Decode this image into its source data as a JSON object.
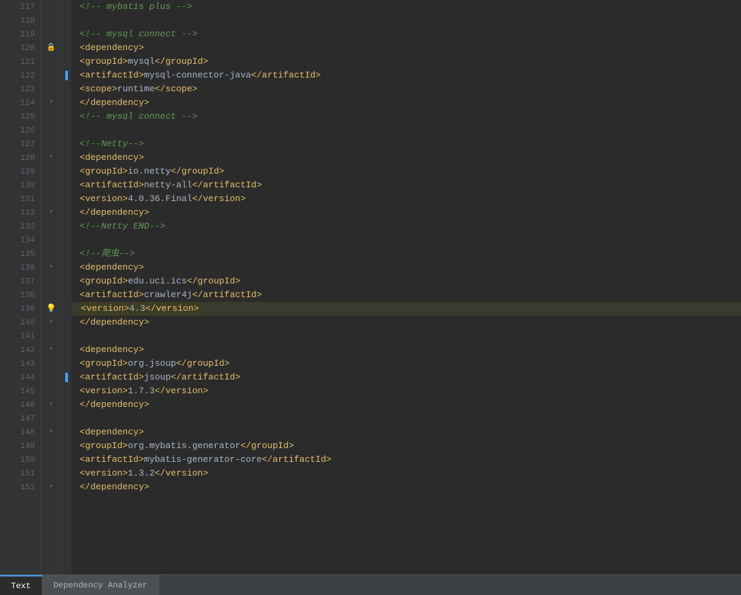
{
  "editor": {
    "lines": [
      {
        "num": 117,
        "indent": 0,
        "gutter": "",
        "side": "",
        "content": "comment",
        "text": "<!-- mybatis plus -->",
        "highlight": false
      },
      {
        "num": 118,
        "indent": 0,
        "gutter": "",
        "side": "",
        "content": "empty",
        "text": "",
        "highlight": false
      },
      {
        "num": 119,
        "indent": 0,
        "gutter": "",
        "side": "",
        "content": "comment",
        "text": "<!-- mysql connect -->",
        "highlight": false
      },
      {
        "num": 120,
        "indent": 0,
        "gutter": "lock",
        "side": "",
        "content": "open-tag",
        "text": "<dependency>",
        "highlight": false
      },
      {
        "num": 121,
        "indent": 1,
        "gutter": "",
        "side": "",
        "content": "element",
        "text": "<groupId>mysql</groupId>",
        "highlight": false
      },
      {
        "num": 122,
        "indent": 1,
        "gutter": "",
        "side": "blue",
        "content": "element",
        "text": "<artifactId>mysql-connector-java</artifactId>",
        "highlight": false
      },
      {
        "num": 123,
        "indent": 1,
        "gutter": "",
        "side": "",
        "content": "element",
        "text": "<scope>runtime</scope>",
        "highlight": false
      },
      {
        "num": 124,
        "indent": 0,
        "gutter": "fold",
        "side": "",
        "content": "close-tag",
        "text": "</dependency>",
        "highlight": false
      },
      {
        "num": 125,
        "indent": 0,
        "gutter": "",
        "side": "",
        "content": "comment",
        "text": "<!-- mysql connect -->",
        "highlight": false
      },
      {
        "num": 126,
        "indent": 0,
        "gutter": "",
        "side": "",
        "content": "empty",
        "text": "",
        "highlight": false
      },
      {
        "num": 127,
        "indent": 0,
        "gutter": "",
        "side": "",
        "content": "comment",
        "text": "<!--Netty-->",
        "highlight": false
      },
      {
        "num": 128,
        "indent": 0,
        "gutter": "fold",
        "side": "",
        "content": "open-tag",
        "text": "<dependency>",
        "highlight": false
      },
      {
        "num": 129,
        "indent": 1,
        "gutter": "",
        "side": "",
        "content": "element",
        "text": "<groupId>io.netty</groupId>",
        "highlight": false
      },
      {
        "num": 130,
        "indent": 1,
        "gutter": "",
        "side": "",
        "content": "element",
        "text": "<artifactId>netty-all</artifactId>",
        "highlight": false
      },
      {
        "num": 131,
        "indent": 1,
        "gutter": "",
        "side": "",
        "content": "element",
        "text": "<version>4.0.36.Final</version>",
        "highlight": false
      },
      {
        "num": 132,
        "indent": 0,
        "gutter": "fold",
        "side": "",
        "content": "close-tag",
        "text": "</dependency>",
        "highlight": false
      },
      {
        "num": 133,
        "indent": 0,
        "gutter": "",
        "side": "",
        "content": "comment",
        "text": "<!--Netty END-->",
        "highlight": false
      },
      {
        "num": 134,
        "indent": 0,
        "gutter": "",
        "side": "",
        "content": "empty",
        "text": "",
        "highlight": false
      },
      {
        "num": 135,
        "indent": 0,
        "gutter": "",
        "side": "",
        "content": "comment",
        "text": "<!--爬虫-->",
        "highlight": false
      },
      {
        "num": 136,
        "indent": 0,
        "gutter": "fold",
        "side": "",
        "content": "open-tag",
        "text": "<dependency>",
        "highlight": false
      },
      {
        "num": 137,
        "indent": 1,
        "gutter": "",
        "side": "",
        "content": "element",
        "text": "<groupId>edu.uci.ics</groupId>",
        "highlight": false
      },
      {
        "num": 138,
        "indent": 1,
        "gutter": "",
        "side": "",
        "content": "element",
        "text": "<artifactId>crawler4j</artifactId>",
        "highlight": false
      },
      {
        "num": 139,
        "indent": 1,
        "gutter": "light",
        "side": "",
        "content": "element-highlighted",
        "text": "<version>4.3</version>",
        "highlight": true
      },
      {
        "num": 140,
        "indent": 0,
        "gutter": "fold",
        "side": "",
        "content": "close-tag",
        "text": "</dependency>",
        "highlight": false
      },
      {
        "num": 141,
        "indent": 0,
        "gutter": "",
        "side": "",
        "content": "empty",
        "text": "",
        "highlight": false
      },
      {
        "num": 142,
        "indent": 0,
        "gutter": "fold",
        "side": "",
        "content": "open-tag",
        "text": "<dependency>",
        "highlight": false
      },
      {
        "num": 143,
        "indent": 1,
        "gutter": "",
        "side": "",
        "content": "element",
        "text": "<groupId>org.jsoup</groupId>",
        "highlight": false
      },
      {
        "num": 144,
        "indent": 1,
        "gutter": "",
        "side": "blue2",
        "content": "element",
        "text": "<artifactId>jsoup</artifactId>",
        "highlight": false
      },
      {
        "num": 145,
        "indent": 1,
        "gutter": "",
        "side": "",
        "content": "element",
        "text": "<version>1.7.3</version>",
        "highlight": false
      },
      {
        "num": 146,
        "indent": 0,
        "gutter": "fold",
        "side": "",
        "content": "close-tag",
        "text": "</dependency>",
        "highlight": false
      },
      {
        "num": 147,
        "indent": 0,
        "gutter": "",
        "side": "",
        "content": "empty",
        "text": "",
        "highlight": false
      },
      {
        "num": 148,
        "indent": 0,
        "gutter": "fold",
        "side": "",
        "content": "open-tag",
        "text": "<dependency>",
        "highlight": false
      },
      {
        "num": 149,
        "indent": 1,
        "gutter": "",
        "side": "",
        "content": "element",
        "text": "<groupId>org.mybatis.generator</groupId>",
        "highlight": false
      },
      {
        "num": 150,
        "indent": 1,
        "gutter": "",
        "side": "",
        "content": "element",
        "text": "<artifactId>mybatis-generator-core</artifactId>",
        "highlight": false
      },
      {
        "num": 151,
        "indent": 1,
        "gutter": "",
        "side": "",
        "content": "element",
        "text": "<version>1.3.2</version>",
        "highlight": false
      },
      {
        "num": 152,
        "indent": 0,
        "gutter": "fold",
        "side": "",
        "content": "close-tag",
        "text": "</dependency>",
        "highlight": false
      }
    ]
  },
  "tabs": [
    {
      "id": "text",
      "label": "Text",
      "active": true
    },
    {
      "id": "dependency-analyzer",
      "label": "Dependency Analyzer",
      "active": false
    }
  ]
}
